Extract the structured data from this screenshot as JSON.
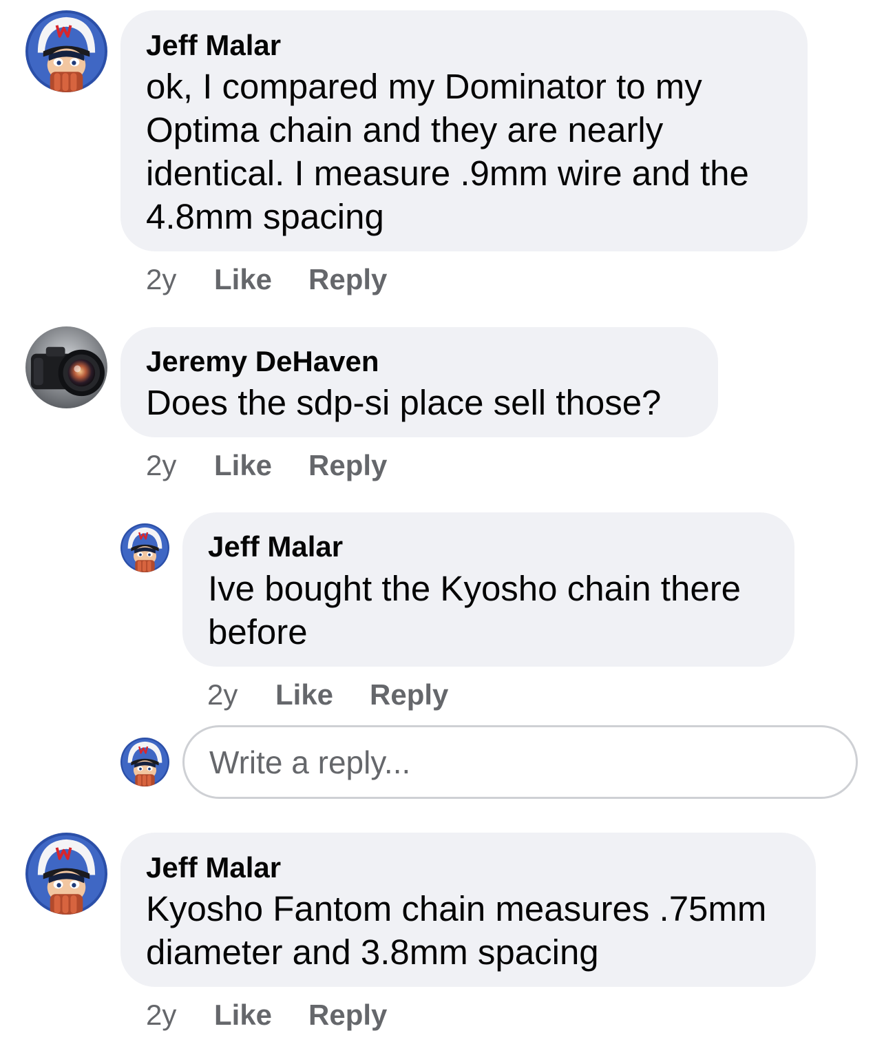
{
  "comments": [
    {
      "author": "Jeff Malar",
      "lines": [
        "ok, I compared my Dominator to my",
        "Optima chain and they are nearly",
        "identical. I measure .9mm wire and the",
        "4.8mm spacing"
      ],
      "time": "2y",
      "like_label": "Like",
      "reply_label": "Reply",
      "avatar_icon": "speed-racer-avatar-icon"
    },
    {
      "author": "Jeremy DeHaven",
      "lines": [
        "Does the sdp-si place sell those?"
      ],
      "time": "2y",
      "like_label": "Like",
      "reply_label": "Reply",
      "avatar_icon": "camera-avatar-icon"
    },
    {
      "author": "Jeff Malar",
      "lines": [
        "Ive bought the Kyosho chain there",
        "before"
      ],
      "time": "2y",
      "like_label": "Like",
      "reply_label": "Reply",
      "avatar_icon": "speed-racer-avatar-icon"
    },
    {
      "author": "Jeff Malar",
      "lines": [
        "Kyosho Fantom chain measures .75mm",
        "diameter and 3.8mm spacing"
      ],
      "time": "2y",
      "like_label": "Like",
      "reply_label": "Reply",
      "avatar_icon": "speed-racer-avatar-icon"
    }
  ],
  "reply_box": {
    "placeholder": "Write a reply...",
    "avatar_icon": "speed-racer-avatar-icon"
  },
  "colors": {
    "bubble_background": "#f0f1f5",
    "secondary_text": "#65676b",
    "input_border": "#ced0d4",
    "avatar_helmet_ring": "#2e4a9e"
  }
}
